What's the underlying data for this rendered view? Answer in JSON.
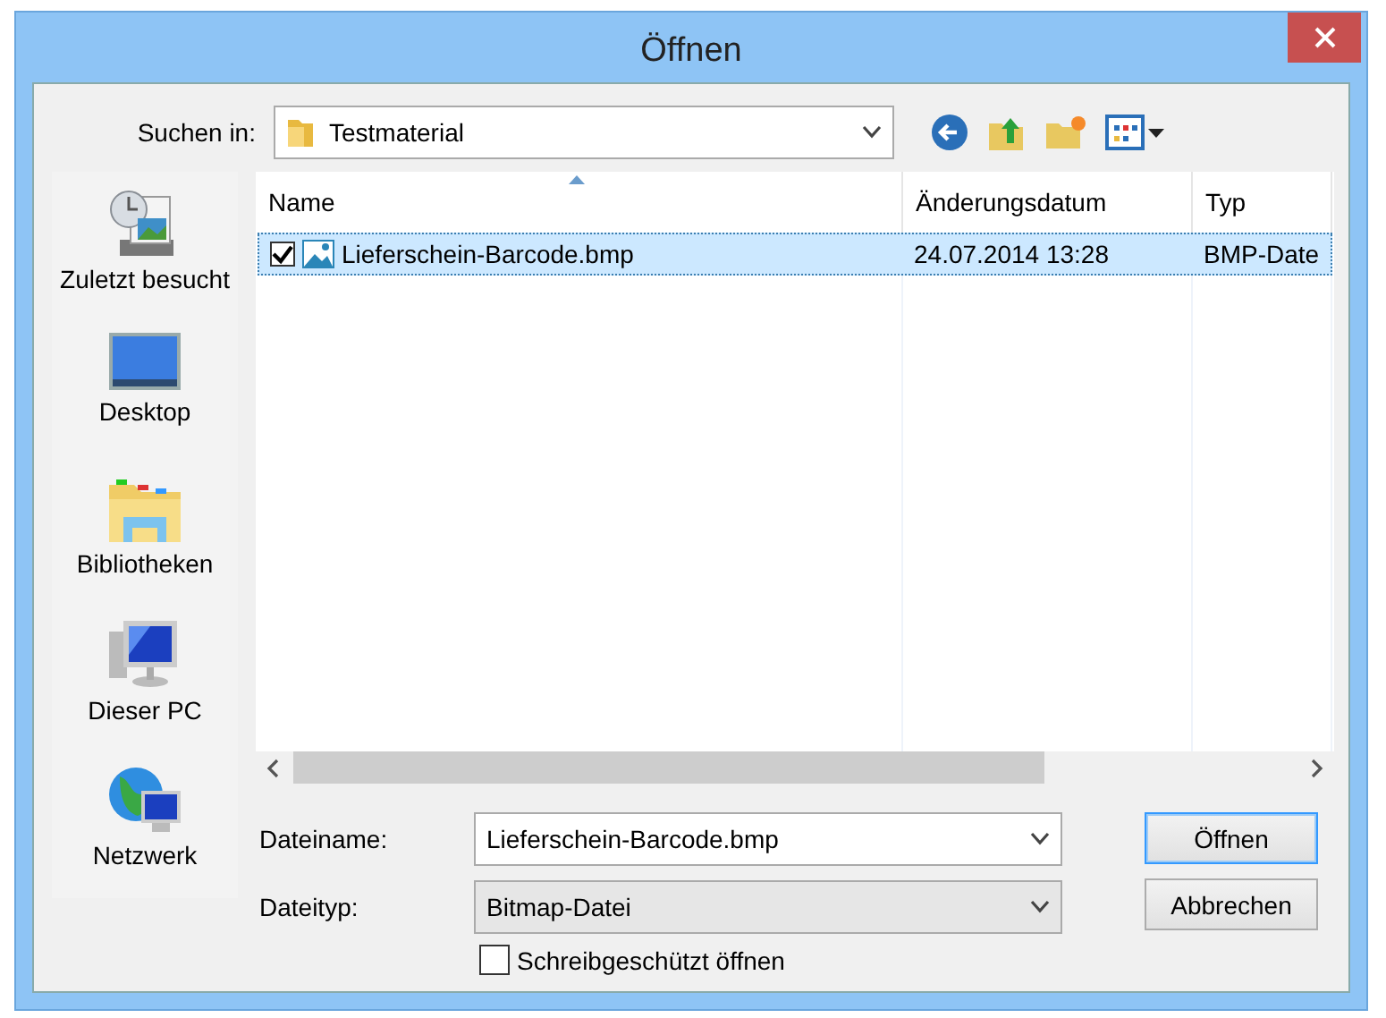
{
  "window": {
    "title": "Öffnen"
  },
  "look_in": {
    "label": "Suchen in:",
    "value": "Testmaterial"
  },
  "places": [
    {
      "label": "Zuletzt besucht",
      "kind": "recent"
    },
    {
      "label": "Desktop",
      "kind": "desktop"
    },
    {
      "label": "Bibliotheken",
      "kind": "libraries"
    },
    {
      "label": "Dieser PC",
      "kind": "pc"
    },
    {
      "label": "Netzwerk",
      "kind": "network"
    }
  ],
  "columns": [
    {
      "label": "Name",
      "sorted": true
    },
    {
      "label": "Änderungsdatum",
      "sorted": false
    },
    {
      "label": "Typ",
      "sorted": false
    }
  ],
  "rows": [
    {
      "name": "Lieferschein-Barcode.bmp",
      "date": "24.07.2014 13:28",
      "type": "BMP-Date",
      "selected": true,
      "checked": true
    }
  ],
  "filename": {
    "label": "Dateiname:",
    "value": "Lieferschein-Barcode.bmp"
  },
  "filetype": {
    "label": "Dateityp:",
    "value": "Bitmap-Datei"
  },
  "readonly": {
    "label": "Schreibgeschützt öffnen",
    "checked": false
  },
  "buttons": [
    {
      "label": "Öffnen",
      "default": true
    },
    {
      "label": "Abbrechen",
      "default": false
    }
  ]
}
